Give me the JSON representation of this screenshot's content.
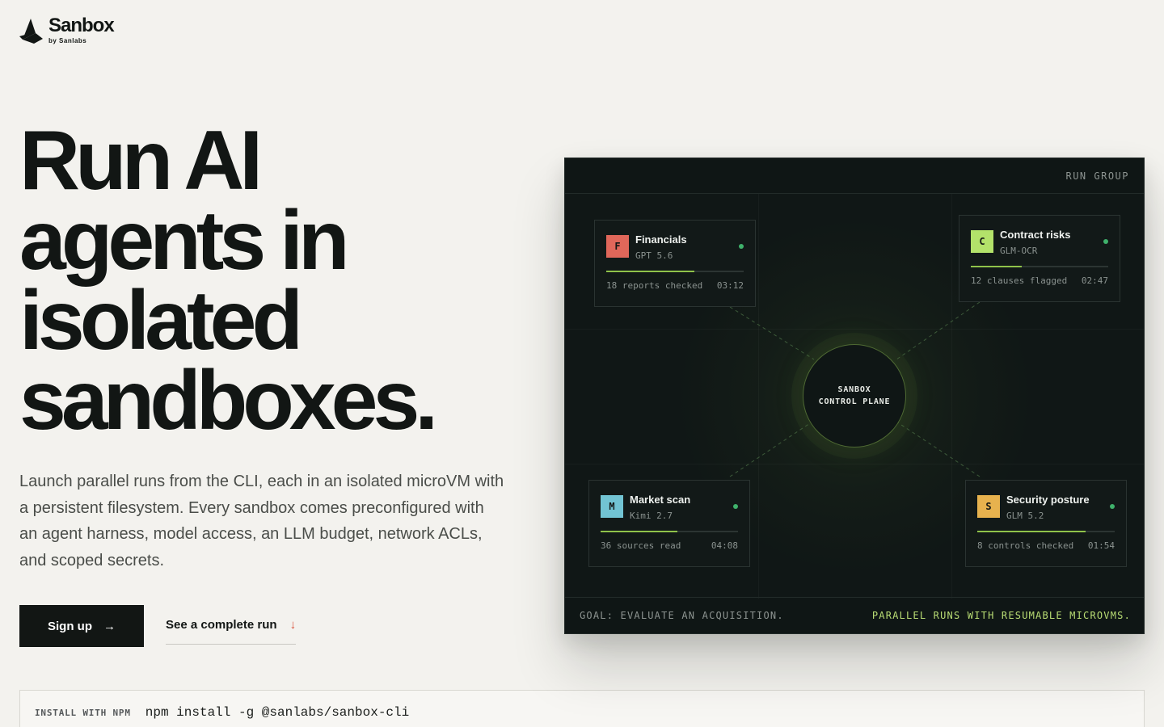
{
  "brand": {
    "name": "Sanbox",
    "by": "by Sanlabs"
  },
  "hero": {
    "title_lines": [
      "Run AI",
      "agents in",
      "isolated",
      "sandboxes."
    ],
    "subtitle": "Launch parallel runs from the CLI, each in an isolated microVM with a persistent filesystem. Every sandbox comes preconfigured with an agent harness, model access, an LLM budget, network ACLs, and scoped secrets.",
    "signup_label": "Sign up",
    "signup_arrow": "→",
    "run_label": "See a complete run",
    "run_arrow": "↓"
  },
  "install": {
    "label": "INSTALL WITH NPM",
    "command": "npm install -g @sanlabs/sanbox-cli"
  },
  "panel": {
    "header": "RUN GROUP",
    "core_lines": [
      "SANBOX",
      "CONTROL PLANE"
    ],
    "goal": "GOAL: EVALUATE AN ACQUISITION.",
    "tagline": "PARALLEL RUNS WITH RESUMABLE MICROVMS.",
    "cards": [
      {
        "badge": "F",
        "name": "Financials",
        "model": "GPT 5.6",
        "stat": "18 reports checked",
        "time": "03:12",
        "progress": 0.64,
        "color": "#e0675a"
      },
      {
        "badge": "C",
        "name": "Contract risks",
        "model": "GLM-OCR",
        "stat": "12 clauses flagged",
        "time": "02:47",
        "progress": 0.37,
        "color": "#b3e26a"
      },
      {
        "badge": "M",
        "name": "Market scan",
        "model": "Kimi 2.7",
        "stat": "36 sources read",
        "time": "04:08",
        "progress": 0.56,
        "color": "#72c4d3"
      },
      {
        "badge": "S",
        "name": "Security posture",
        "model": "GLM 5.2",
        "stat": "8 controls checked",
        "time": "01:54",
        "progress": 0.79,
        "color": "#e7b24e"
      }
    ]
  },
  "colors": {
    "background": "#f3f2ee",
    "ink": "#121614",
    "panel": "#0f1615",
    "accent_green": "#8fc24a",
    "status_green": "#3fb16b",
    "link_arrow": "#d9503a"
  }
}
